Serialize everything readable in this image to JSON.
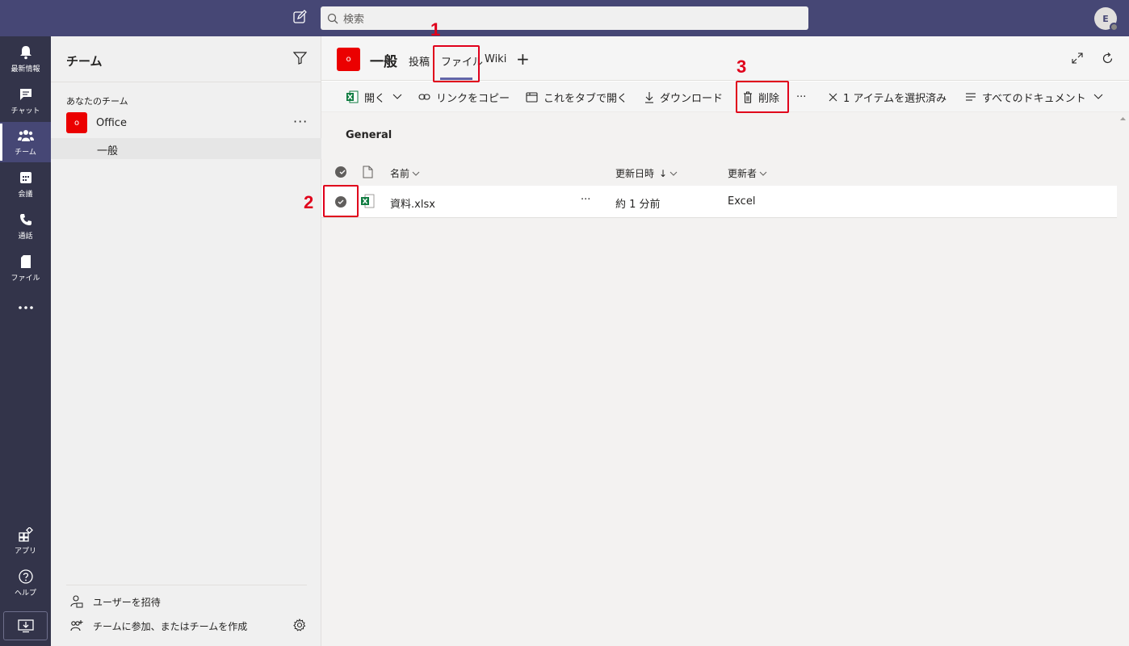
{
  "topbar": {
    "search_placeholder": "検索",
    "avatar_initial": "E"
  },
  "rail": {
    "items": [
      {
        "label": "最新情報",
        "icon": "bell-icon"
      },
      {
        "label": "チャット",
        "icon": "chat-icon"
      },
      {
        "label": "チーム",
        "icon": "teams-icon",
        "active": true
      },
      {
        "label": "会議",
        "icon": "calendar-icon"
      },
      {
        "label": "通話",
        "icon": "phone-icon"
      },
      {
        "label": "ファイル",
        "icon": "file-icon"
      },
      {
        "label": "",
        "icon": "more-icon"
      },
      {
        "label": "アプリ",
        "icon": "apps-icon"
      },
      {
        "label": "ヘルプ",
        "icon": "help-icon"
      }
    ]
  },
  "panel": {
    "title": "チーム",
    "section_label": "あなたのチーム",
    "team": {
      "logo_letter": "o",
      "name": "Office"
    },
    "channel": "一般",
    "footer": {
      "invite": "ユーザーを招待",
      "join": "チームに参加、またはチームを作成"
    }
  },
  "header": {
    "logo_letter": "o",
    "title": "一般",
    "tabs": [
      {
        "label": "投稿"
      },
      {
        "label": "ファイル",
        "active": true
      },
      {
        "label": "Wiki"
      }
    ]
  },
  "toolbar": {
    "open": "開く",
    "copy_link": "リンクをコピー",
    "open_tab": "これをタブで開く",
    "download": "ダウンロード",
    "delete": "削除",
    "more": "···",
    "selected": "1 アイテムを選択済み",
    "all_docs": "すべてのドキュメント"
  },
  "library": {
    "title": "General",
    "columns": {
      "name": "名前",
      "modified": "更新日時",
      "modified_sort": "↓",
      "modified_by": "更新者"
    },
    "files": [
      {
        "name": "資料.xlsx",
        "more": "···",
        "modified": "約 1 分前",
        "modified_by": "Excel"
      }
    ]
  },
  "callouts": [
    "1",
    "2",
    "3"
  ],
  "colors": {
    "topbar": "#464775",
    "rail": "#33344a",
    "accent": "#6264a7",
    "callout": "#e0001b",
    "team_logo": "#eb0000"
  }
}
